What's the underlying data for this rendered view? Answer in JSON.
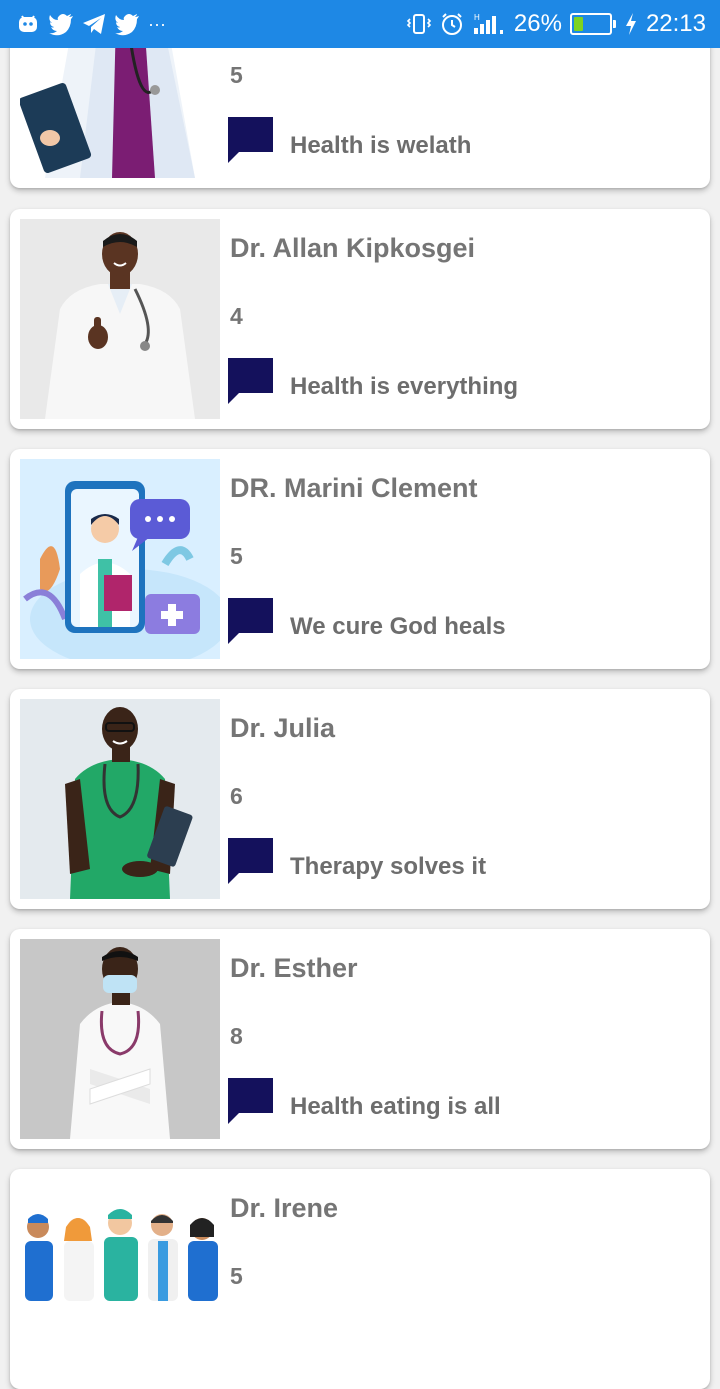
{
  "status_bar": {
    "battery_percent": "26%",
    "battery_level": 0.26,
    "time": "22:13",
    "left_dots": "···"
  },
  "doctors": [
    {
      "name": "",
      "rating": "5",
      "quote": "Health is welath",
      "image": "female-doctor-clipboard"
    },
    {
      "name": "Dr. Allan Kipkosgei",
      "rating": "4",
      "quote": "Health is everything",
      "image": "doctor-thumbs-up"
    },
    {
      "name": "DR. Marini Clement",
      "rating": "5",
      "quote": "We cure God heals",
      "image": "telemedicine-illustration"
    },
    {
      "name": "Dr. Julia",
      "rating": "6",
      "quote": "Therapy solves it",
      "image": "doctor-green-scrubs"
    },
    {
      "name": "Dr. Esther",
      "rating": "8",
      "quote": "Health eating is all",
      "image": "doctor-face-mask"
    },
    {
      "name": "Dr. Irene",
      "rating": "5",
      "quote": "",
      "image": "medical-team-illustration"
    }
  ],
  "colors": {
    "status_bar": "#1e88e5",
    "chat_icon": "#14115c",
    "text": "#757575"
  }
}
